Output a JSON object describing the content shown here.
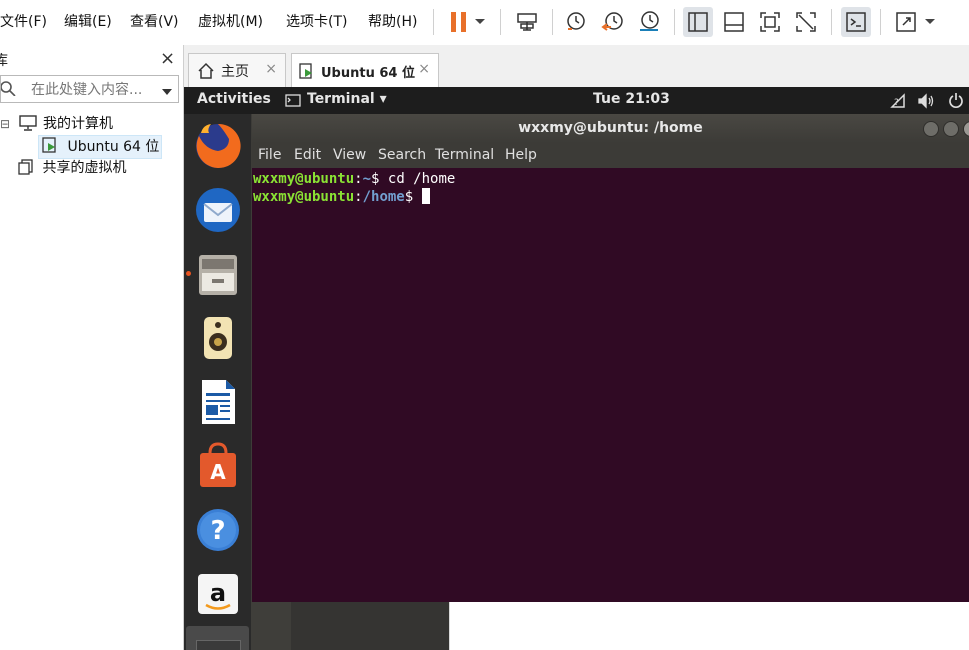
{
  "menubar": {
    "items": [
      "文件(F)",
      "编辑(E)",
      "查看(V)",
      "虚拟机(M)",
      "选项卡(T)",
      "帮助(H)"
    ]
  },
  "toolbar": {
    "accent_color": "#e8702a",
    "icons": [
      "pause-icon",
      "dropdown-icon",
      "send-keys-icon",
      "snapshot-icon",
      "revert-snapshot-icon",
      "snapshot-manager-icon",
      "library-view-icon",
      "console-view-icon",
      "fullscreen-icon",
      "unity-icon",
      "terminal-icon",
      "stretch-icon"
    ]
  },
  "sidebar": {
    "header_fragment": "库",
    "close": "×",
    "search_placeholder": "在此处键入内容...",
    "tree": {
      "collapse": "⊟",
      "my_computer": "我的计算机",
      "vm": "Ubuntu 64 位",
      "shared": "共享的虚拟机"
    }
  },
  "tabs": [
    {
      "label": "主页",
      "close": "×"
    },
    {
      "label": "Ubuntu 64 位",
      "close": "×"
    }
  ],
  "guest": {
    "panel": {
      "activities": "Activities",
      "app_menu": "Terminal ▾",
      "clock": "Tue 21:03",
      "tray": [
        "network-icon",
        "volume-icon",
        "power-icon"
      ]
    },
    "dock": [
      "firefox-icon",
      "thunderbird-icon",
      "files-icon",
      "rhythmbox-icon",
      "writer-icon",
      "software-center-icon",
      "help-icon",
      "amazon-icon"
    ],
    "terminal": {
      "title": "wxxmy@ubuntu: /home",
      "menu": [
        "File",
        "Edit",
        "View",
        "Search",
        "Terminal",
        "Help"
      ],
      "lines": [
        {
          "user": "wxxmy@ubuntu",
          "sep": ":",
          "path": "~",
          "prompt": "$ ",
          "cmd": "cd /home"
        },
        {
          "user": "wxxmy@ubuntu",
          "sep": ":",
          "path": "/home",
          "prompt": "$ ",
          "cmd": ""
        }
      ]
    }
  }
}
